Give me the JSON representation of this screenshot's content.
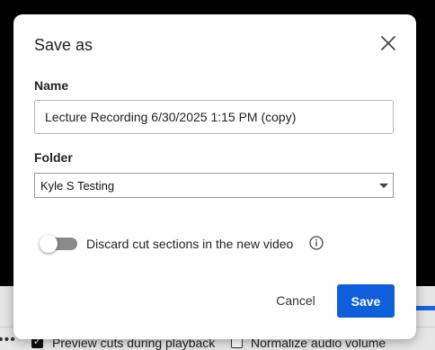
{
  "dialog": {
    "title": "Save as",
    "name_label": "Name",
    "name_value": "Lecture Recording 6/30/2025 1:15 PM (copy)",
    "folder_label": "Folder",
    "folder_value": "Kyle S Testing",
    "discard_toggle": {
      "label": "Discard cut sections in the new video",
      "on": false
    },
    "cancel_label": "Cancel",
    "save_label": "Save",
    "icons": {
      "close": "close-icon",
      "info": "info-icon",
      "dropdown": "chevron-down-icon"
    }
  },
  "background": {
    "dots": "•••",
    "preview_cuts_label": "Preview cuts during playback",
    "preview_cuts_checked": true,
    "normalize_label": "Normalize audio volume",
    "normalize_checked": false
  },
  "colors": {
    "primary": "#0f5fdc",
    "overlay": "#000000"
  }
}
